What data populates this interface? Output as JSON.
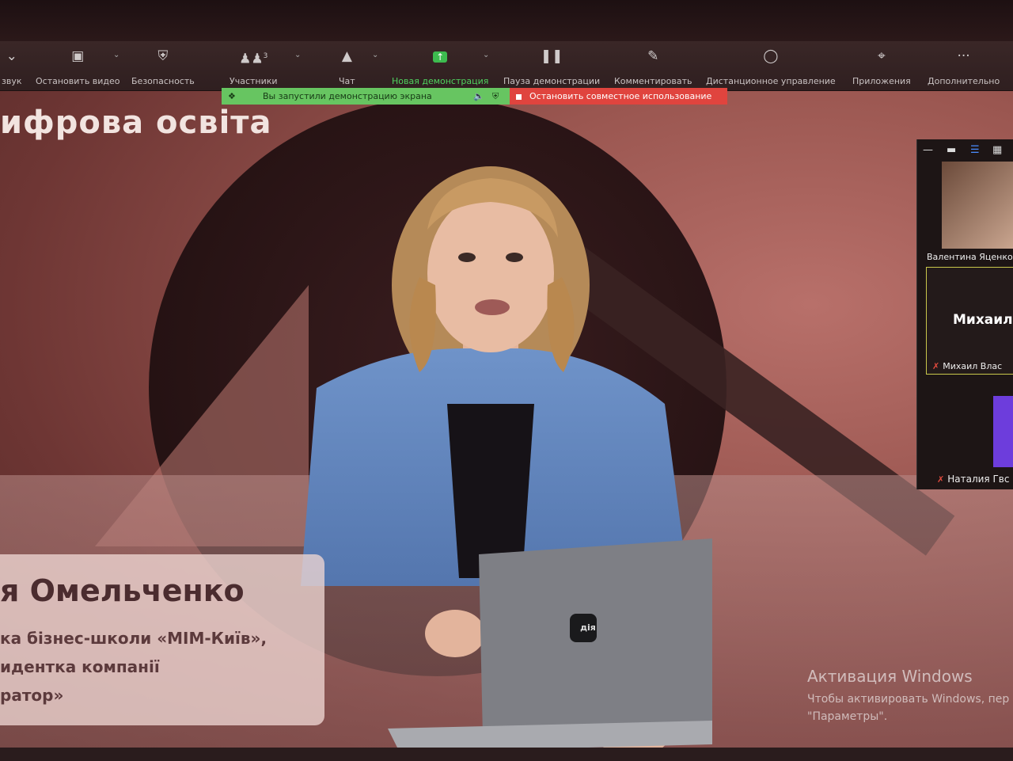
{
  "toolbar": {
    "items": [
      {
        "icon": "mic-icon",
        "label": "звук"
      },
      {
        "icon": "video-icon",
        "label": "Остановить видео"
      },
      {
        "icon": "shield-icon",
        "label": "Безопасность"
      },
      {
        "icon": "participants-icon",
        "label": "Участники",
        "count": "3"
      },
      {
        "icon": "chat-icon",
        "label": "Чат"
      },
      {
        "icon": "share-screen-icon",
        "label": "Новая демонстрация"
      },
      {
        "icon": "pause-icon",
        "label": "Пауза демонстрации"
      },
      {
        "icon": "pen-icon",
        "label": "Комментировать"
      },
      {
        "icon": "mouse-icon",
        "label": "Дистанционное управление"
      },
      {
        "icon": "apps-icon",
        "label": "Приложения"
      },
      {
        "icon": "more-icon",
        "label": "Дополнительно"
      }
    ]
  },
  "share_banner": {
    "status": "Вы запустили демонстрацию экрана",
    "stop_label": "Остановить совместное использование"
  },
  "slide": {
    "title": "ифрова освіта",
    "name": "я Омельченко",
    "lines": [
      "ка бізнес-школи «МІМ-Київ»,",
      "идентка компанії",
      "ратор»"
    ],
    "laptop_logo": "дія"
  },
  "gallery": {
    "participants": [
      {
        "name": "Валентина Яценко"
      },
      {
        "display": "Михаил",
        "name": "Михаил Влас"
      },
      {
        "name": "Наталия Гвс"
      }
    ]
  },
  "watermark": {
    "title": "Активация Windows",
    "line1": "Чтобы активировать Windows, пер",
    "line2": "\"Параметры\"."
  }
}
